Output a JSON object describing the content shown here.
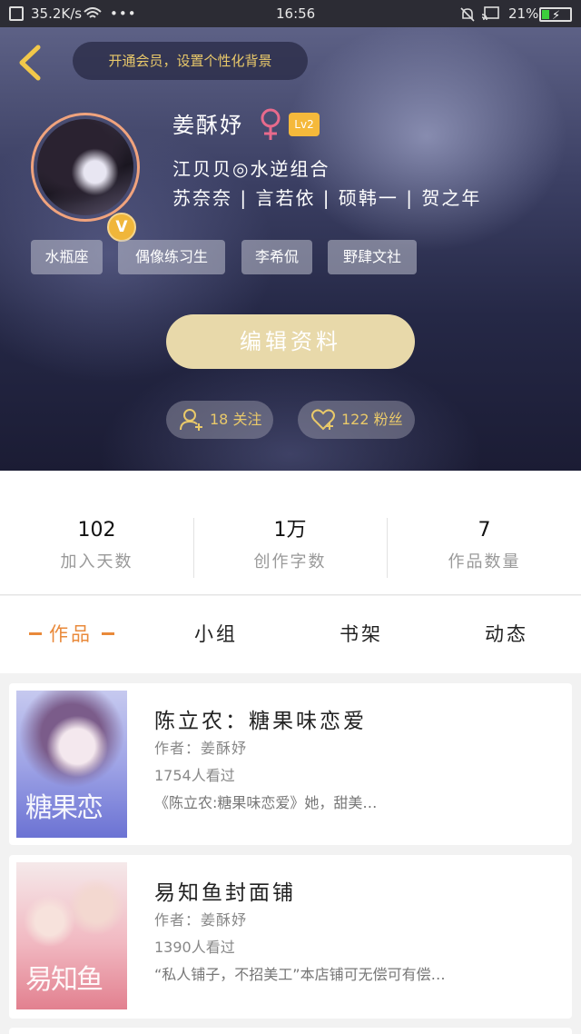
{
  "status_bar": {
    "speed": "35.2K/s",
    "dots": "•••",
    "time": "16:56",
    "battery": "21%"
  },
  "header": {
    "vip_banner": "开通会员，设置个性化背景",
    "username": "姜酥妤",
    "level": "Lv2",
    "vip_badge": "V",
    "line1": "江贝贝◎水逆组合",
    "line2": "苏奈奈 | 言若依 | 硕韩一 | 贺之年",
    "tags": [
      "水瓶座",
      "偶像练习生",
      "李希侃",
      "野肆文社"
    ],
    "edit_button": "编辑资料",
    "following": "18 关注",
    "followers": "122 粉丝"
  },
  "stats": [
    {
      "value": "102",
      "label": "加入天数"
    },
    {
      "value": "1万",
      "label": "创作字数"
    },
    {
      "value": "7",
      "label": "作品数量"
    }
  ],
  "tabs": [
    {
      "label": "作品",
      "active": true
    },
    {
      "label": "小组",
      "active": false
    },
    {
      "label": "书架",
      "active": false
    },
    {
      "label": "动态",
      "active": false
    }
  ],
  "works": [
    {
      "title": "陈立农：糖果味恋爱",
      "author": "作者：姜酥妤",
      "views": "1754人看过",
      "description": "《陈立农:糖果味恋爱》她，甜美…",
      "cover_text": "糖果恋"
    },
    {
      "title": "易知鱼封面铺",
      "author": "作者：姜酥妤",
      "views": "1390人看过",
      "description": "“私人铺子，不招美工”本店铺可无偿可有偿…",
      "cover_text": "易知鱼"
    }
  ],
  "colors": {
    "accent": "#e9893a",
    "gold": "#e9c96a",
    "level_badge": "#f5b93b",
    "edit_button": "#e8d9aa"
  }
}
